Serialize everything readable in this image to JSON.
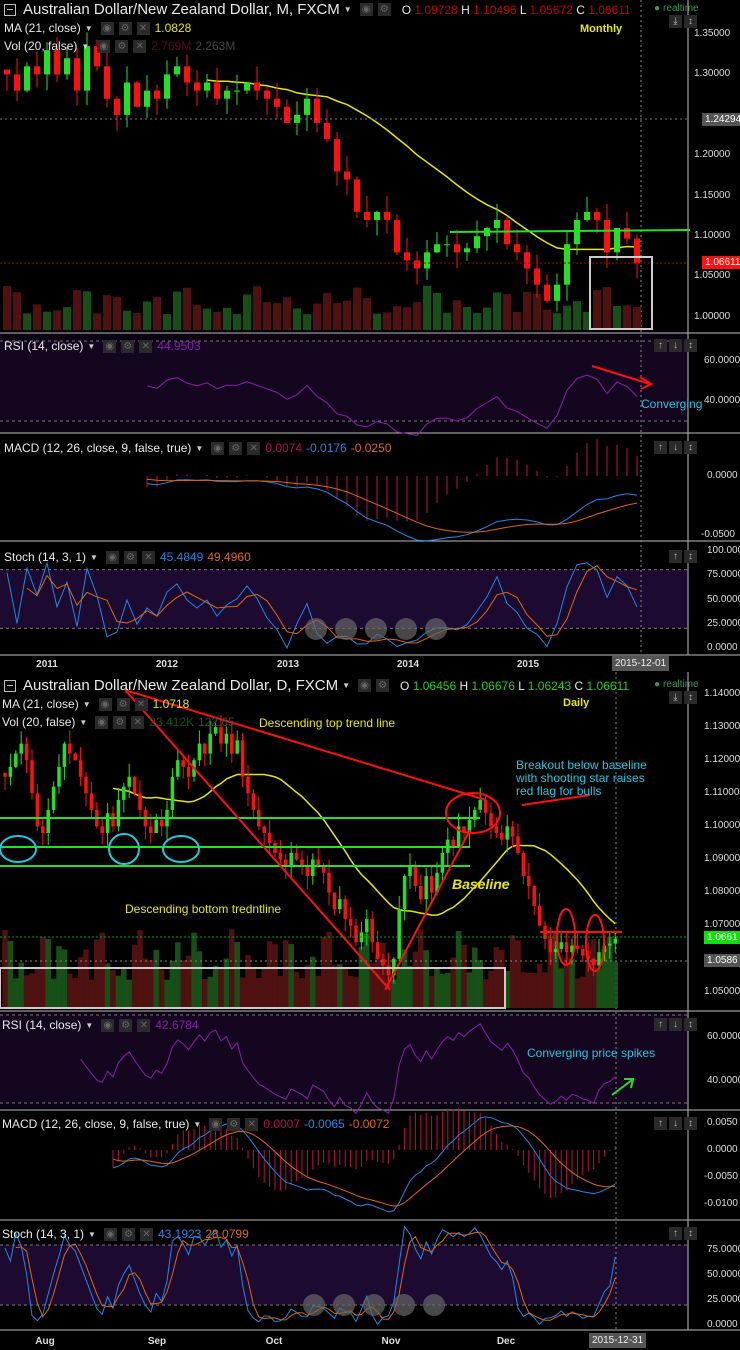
{
  "monthly": {
    "title": "Australian Dollar/New Zealand Dollar, M, FXCM",
    "ohlc": {
      "o_label": "O",
      "o": "1.09728",
      "h_label": "H",
      "h": "1.10496",
      "l_label": "L",
      "l": "1.05672",
      "c_label": "C",
      "c": "1.06611"
    },
    "ma": {
      "label": "MA (21, close)",
      "value": "1.0828"
    },
    "vol": {
      "label": "Vol (20, false)",
      "v1": "2.769M",
      "v2": "2.263M"
    },
    "period_label": "Monthly",
    "realtime": "realtime",
    "price_ticks": [
      "1.35000",
      "1.30000",
      "1.20000",
      "1.15000",
      "1.10000",
      "1.05000",
      "1.00000"
    ],
    "crosshair_price": "1.24294",
    "last_price": "1.06611",
    "rsi": {
      "label": "RSI (14, close)",
      "value": "44.9503",
      "ticks": [
        "60.0000",
        "40.0000"
      ]
    },
    "macd": {
      "label": "MACD (12, 26, close, 9, false, true)",
      "hist": "0.0074",
      "macd": "-0.0176",
      "signal": "-0.0250",
      "ticks": [
        "0.0000",
        "-0.0500"
      ]
    },
    "stoch": {
      "label": "Stoch (14, 3, 1)",
      "k": "45.4849",
      "d": "49.4960",
      "ticks": [
        "100.0000",
        "75.0000",
        "50.0000",
        "25.0000",
        "0.0000"
      ]
    },
    "time_labels": [
      "2011",
      "2012",
      "2013",
      "2014",
      "2015"
    ],
    "cursor_date": "2015-12-01",
    "annotation_converging": "Converging",
    "colors": {
      "up": "#22e022",
      "down": "#ff1010",
      "ma": "#e6e600"
    },
    "closes": [
      1.3,
      1.28,
      1.31,
      1.3,
      1.33,
      1.3,
      1.32,
      1.28,
      1.335,
      1.31,
      1.27,
      1.25,
      1.29,
      1.26,
      1.28,
      1.27,
      1.3,
      1.31,
      1.29,
      1.28,
      1.29,
      1.27,
      1.28,
      1.28,
      1.29,
      1.28,
      1.27,
      1.26,
      1.24,
      1.25,
      1.27,
      1.24,
      1.22,
      1.18,
      1.17,
      1.13,
      1.12,
      1.13,
      1.12,
      1.08,
      1.07,
      1.06,
      1.08,
      1.09,
      1.09,
      1.08,
      1.085,
      1.1,
      1.11,
      1.12,
      1.09,
      1.08,
      1.06,
      1.04,
      1.02,
      1.04,
      1.09,
      1.12,
      1.13,
      1.12,
      1.08,
      1.11,
      1.097,
      1.0661
    ]
  },
  "daily": {
    "title": "Australian Dollar/New Zealand Dollar, D, FXCM",
    "ohlc": {
      "o_label": "O",
      "o": "1.06456",
      "h_label": "H",
      "h": "1.06676",
      "l_label": "L",
      "l": "1.06243",
      "c_label": "C",
      "c": "1.06611"
    },
    "ma": {
      "label": "MA (21, close)",
      "value": "1.0718"
    },
    "vol": {
      "label": "Vol (20, false)",
      "v1": "23.412K",
      "v2": "122.65"
    },
    "period_label": "Daily",
    "realtime": "realtime",
    "price_ticks": [
      "1.14000",
      "1.13000",
      "1.12000",
      "1.11000",
      "1.10000",
      "1.09000",
      "1.08000",
      "1.07000",
      "1.05000"
    ],
    "last_price": "1.0661",
    "crosshair_price": "1.0586",
    "rsi": {
      "label": "RSI (14, close)",
      "value": "42.6784",
      "ticks": [
        "60.0000",
        "40.0000"
      ]
    },
    "macd": {
      "label": "MACD (12, 26, close, 9, false, true)",
      "hist": "0.0007",
      "macd": "-0.0065",
      "signal": "-0.0072",
      "ticks": [
        "0.0050",
        "0.0000",
        "-0.0050",
        "-0.0100"
      ]
    },
    "stoch": {
      "label": "Stoch (14, 3, 1)",
      "k": "43.1923",
      "d": "28.0799",
      "ticks": [
        "75.0000",
        "50.0000",
        "25.0000",
        "0.0000"
      ]
    },
    "time_labels": [
      "Aug",
      "Sep",
      "Oct",
      "Nov",
      "Dec"
    ],
    "cursor_date": "2015-12-31",
    "annotations": {
      "top_trend": "Descending top trend line",
      "breakout": [
        "Breakout below baseline",
        "with shooting star raises",
        "red flag for bulls"
      ],
      "baseline": "Baseline",
      "bottom_trend": "Descending bottom tredntline",
      "converging_spikes": "Converging price spikes"
    },
    "closes": [
      1.115,
      1.118,
      1.122,
      1.125,
      1.12,
      1.11,
      1.1,
      1.098,
      1.105,
      1.112,
      1.118,
      1.125,
      1.122,
      1.12,
      1.115,
      1.11,
      1.105,
      1.1,
      1.098,
      1.104,
      1.1,
      1.108,
      1.112,
      1.115,
      1.11,
      1.105,
      1.1,
      1.098,
      1.102,
      1.1,
      1.105,
      1.115,
      1.12,
      1.118,
      1.115,
      1.12,
      1.125,
      1.122,
      1.128,
      1.13,
      1.125,
      1.128,
      1.122,
      1.126,
      1.115,
      1.11,
      1.105,
      1.1,
      1.098,
      1.095,
      1.092,
      1.09,
      1.088,
      1.092,
      1.09,
      1.088,
      1.085,
      1.09,
      1.088,
      1.086,
      1.08,
      1.075,
      1.078,
      1.072,
      1.07,
      1.065,
      1.068,
      1.072,
      1.065,
      1.06,
      1.058,
      1.055,
      1.06,
      1.075,
      1.085,
      1.088,
      1.082,
      1.078,
      1.085,
      1.08,
      1.086,
      1.092,
      1.096,
      1.094,
      1.1,
      1.098,
      1.102,
      1.105,
      1.108,
      1.104,
      1.1,
      1.098,
      1.096,
      1.1,
      1.097,
      1.092,
      1.085,
      1.082,
      1.076,
      1.07,
      1.066,
      1.062,
      1.063,
      1.065,
      1.062,
      1.064,
      1.063,
      1.061,
      1.06,
      1.058,
      1.062,
      1.064,
      1.0646,
      1.0661
    ]
  }
}
